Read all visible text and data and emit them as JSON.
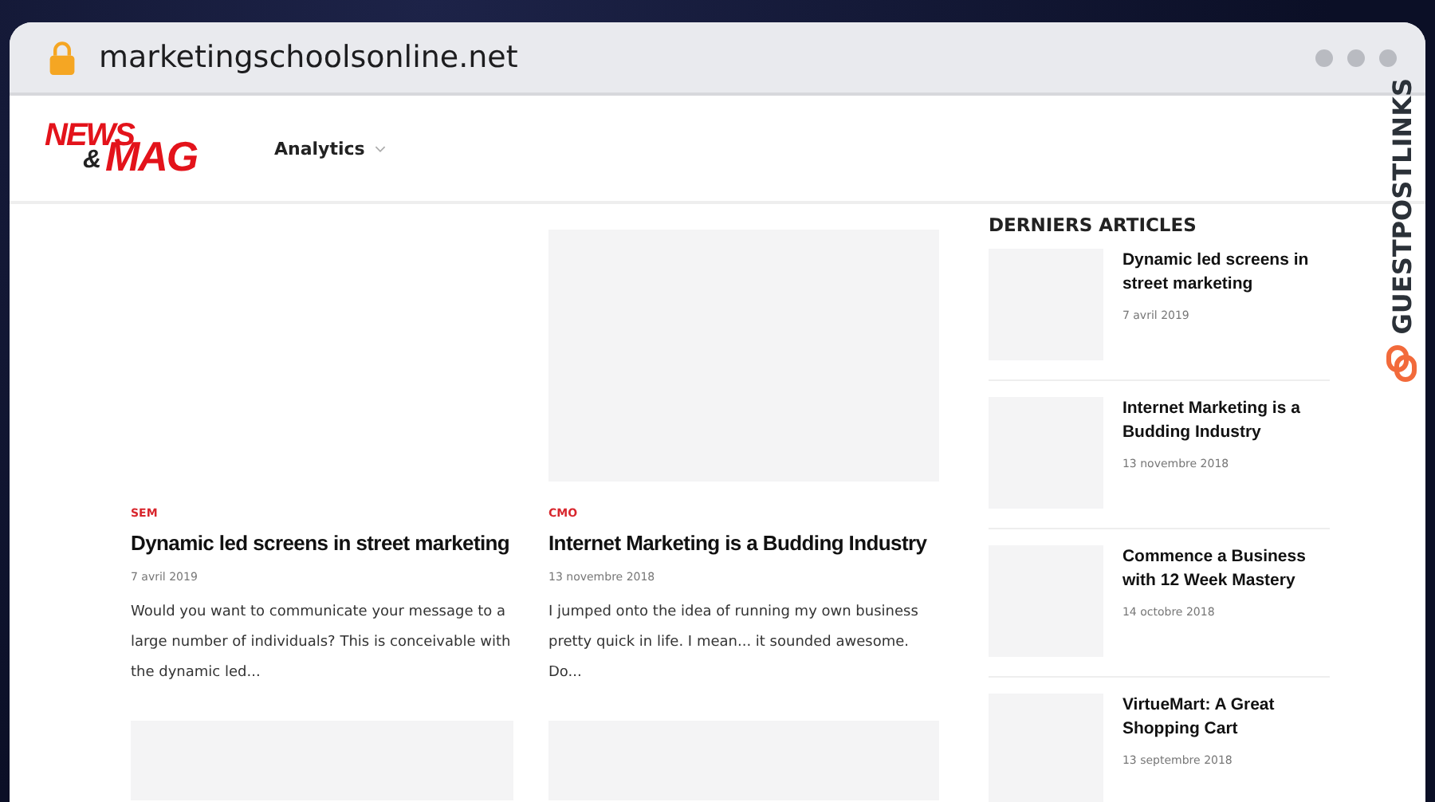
{
  "browser": {
    "url": "marketingschoolsonline.net"
  },
  "site": {
    "logo": [
      "NEWS",
      "&",
      "MAG"
    ],
    "nav": [
      {
        "label": "Analytics"
      }
    ]
  },
  "posts": [
    {
      "kind": "text",
      "category": "SEM",
      "title": "Dynamic led screens in street marketing",
      "date": "7 avril 2019",
      "excerpt": "Would you want to communicate your message to a large number of individuals? This is conceivable with the dynamic led..."
    },
    {
      "kind": "image",
      "category": "CMO",
      "title": "Internet Marketing is a Budding Industry",
      "date": "13 novembre 2018",
      "excerpt": "I jumped onto the idea of running my own business pretty quick in life. I mean... it sounded awesome. Do..."
    }
  ],
  "sidebar": {
    "title": "DERNIERS ARTICLES",
    "items": [
      {
        "title": "Dynamic led screens in street marketing",
        "date": "7 avril 2019"
      },
      {
        "title": "Internet Marketing is a Budding Industry",
        "date": "13 novembre 2018"
      },
      {
        "title": "Commence a Business with 12 Week Mastery",
        "date": "14 octobre 2018"
      },
      {
        "title": "VirtueMart: A Great Shopping Cart",
        "date": "13 septembre 2018"
      }
    ]
  },
  "brand": "GUESTPOSTLINKS"
}
